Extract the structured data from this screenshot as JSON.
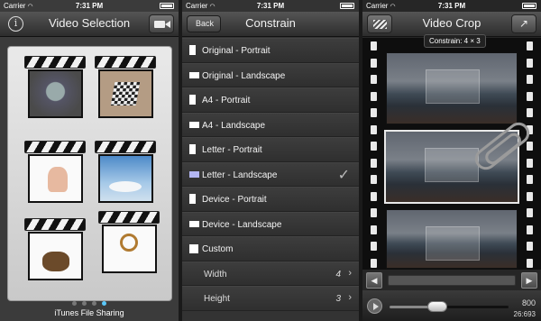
{
  "status": {
    "carrier": "Carrier",
    "time": "7:31 PM"
  },
  "screen1": {
    "title": "Video Selection",
    "info_icon": "info-icon",
    "camera_icon": "video-camera-icon",
    "clips": [
      "clip-1",
      "clip-2",
      "clip-3",
      "clip-4",
      "clip-5",
      "clip-6"
    ],
    "page_count": 4,
    "active_page": 4,
    "footer": "iTunes File Sharing"
  },
  "screen2": {
    "back_label": "Back",
    "title": "Constrain",
    "items": [
      {
        "label": "Original - Portrait",
        "shape": "portrait"
      },
      {
        "label": "Original - Landscape",
        "shape": "landscape"
      },
      {
        "label": "A4 - Portrait",
        "shape": "portrait"
      },
      {
        "label": "A4 - Landscape",
        "shape": "landscape"
      },
      {
        "label": "Letter - Portrait",
        "shape": "portrait"
      },
      {
        "label": "Letter - Landscape",
        "shape": "landscape",
        "selected": true
      },
      {
        "label": "Device - Portrait",
        "shape": "portrait"
      },
      {
        "label": "Device - Landscape",
        "shape": "landscape"
      },
      {
        "label": "Custom",
        "shape": "square"
      }
    ],
    "width_label": "Width",
    "width_value": "4",
    "height_label": "Height",
    "height_value": "3",
    "selected_color": "#b3b6f3"
  },
  "screen3": {
    "title": "Video Crop",
    "constrain_tooltip": "Constrain: 4 × 3",
    "readout_top": "800",
    "readout_bottom": "26:693",
    "progress": 0.4
  }
}
